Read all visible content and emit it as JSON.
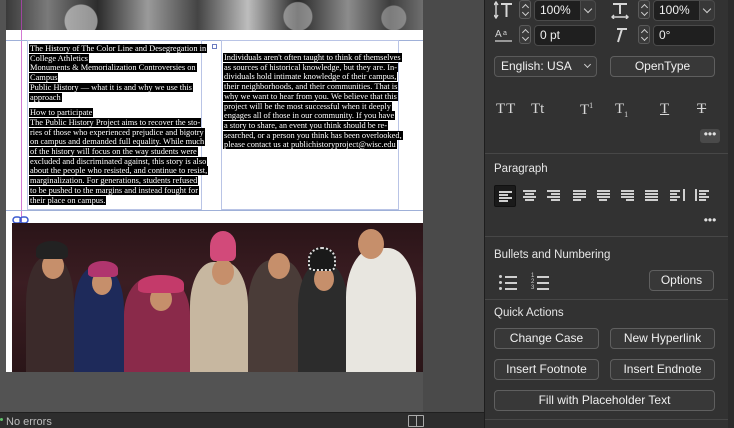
{
  "document": {
    "column1": [
      "The History of The Color Line and Desegregation in",
      "College Athletics",
      "Monuments & Memorialization Controversies on",
      "Campus",
      "Public History — what it is and why we use this",
      "approach",
      "",
      "How to participate",
      "The Public History Project aims to recover the sto-",
      "ries of those who experienced prejudice and bigotry",
      "on campus and demanded full equality. While much",
      "of the history will focus on the way students were",
      "excluded and discriminated against, this story is also",
      "about the people who resisted, and continue to resist,",
      "marginalization. For generations, students refused",
      "to be pushed to the margins and instead fought for",
      "their place on campus."
    ],
    "column2": [
      "Individuals aren't often taught to think of themselves",
      "as sources of historical knowledge, but they are. In-",
      "dividuals hold intimate knowledge of their campus,",
      "their neighborhoods, and their communities. That is",
      "why we want to hear from you. We believe that this",
      "project will be the most successful when it deeply",
      "engages all of those in our community. If you have",
      "a story to share, an event you think should be re-",
      "searched, or a person you think has been overlooked,",
      "please contact us at publichistoryproject@wisc.edu"
    ]
  },
  "status": {
    "errors_label": "No errors"
  },
  "character": {
    "vertical_scale": "100%",
    "horizontal_scale": "100%",
    "baseline_shift": "0 pt",
    "skew": "0°",
    "language": "English: USA",
    "opentype_label": "OpenType",
    "style_buttons": [
      "TT",
      "Tt",
      "T¹",
      "T₁",
      "T",
      "T"
    ]
  },
  "paragraph": {
    "title": "Paragraph"
  },
  "bullets": {
    "title": "Bullets and Numbering",
    "options_label": "Options"
  },
  "quick_actions": {
    "title": "Quick Actions",
    "change_case": "Change Case",
    "new_hyperlink": "New Hyperlink",
    "insert_footnote": "Insert Footnote",
    "insert_endnote": "Insert Endnote",
    "fill_placeholder": "Fill with Placeholder Text"
  },
  "icons": {
    "more": "•••"
  },
  "colors": {
    "panel_bg": "#323232",
    "canvas_bg": "#535353",
    "text_highlight": "#000000"
  }
}
